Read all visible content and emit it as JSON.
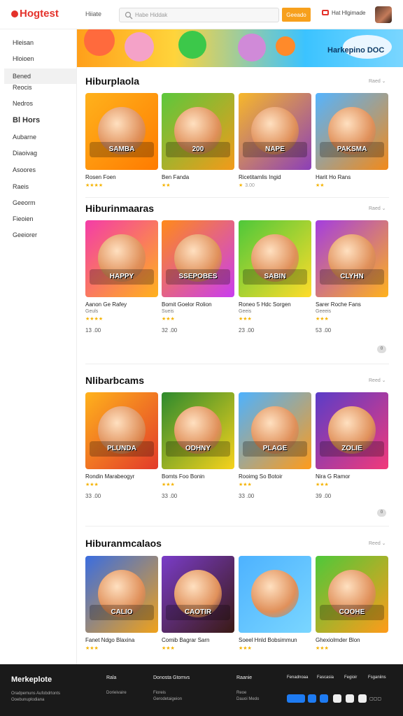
{
  "header": {
    "logo": "Hogtest",
    "nav_link": "Hiiate",
    "search_placeholder": "Habe Hiddak",
    "search_button": "Geeado",
    "signin": "Hat Hlgimade"
  },
  "sidebar": {
    "items": [
      "Hleisan",
      "Hloioen",
      "Bened",
      "Reocis",
      "Nedros",
      "Bl Hors",
      "Aubarne",
      "Diaoivag",
      "Asoores",
      "Raeis",
      "Geeorm",
      "Fieoien",
      "Geeiorer"
    ]
  },
  "banner": {
    "text": "Harkepino DOC"
  },
  "sections": [
    {
      "title": "Hiburplaola",
      "see_all": "Raed",
      "cards": [
        {
          "title": "Rosen Foen",
          "stars": "★★★★",
          "count": "",
          "thumb": "SAMBA",
          "colors": [
            "#ffb21c",
            "#ff7b00"
          ]
        },
        {
          "title": "Ben Fanda",
          "stars": "★★",
          "count": "",
          "thumb": "200",
          "colors": [
            "#5bc83c",
            "#f39a1a"
          ]
        },
        {
          "title": "Ricetitamlis Ingid",
          "stars": "★",
          "count": "3.00",
          "thumb": "NAPE",
          "colors": [
            "#f7b82a",
            "#8c3fb8"
          ]
        },
        {
          "title": "Harit Ho Rans",
          "stars": "★★",
          "count": "",
          "thumb": "PAKSMA",
          "colors": [
            "#54b4ff",
            "#f28a1a"
          ]
        }
      ]
    },
    {
      "title": "Hiburinmaaras",
      "see_all": "Raed",
      "cards": [
        {
          "title": "Aanon Ge Rafey",
          "sub": "Geuls",
          "stars": "★★★★",
          "price": "13 .00",
          "thumb": "HAPPY",
          "colors": [
            "#f43ca8",
            "#ffb21c"
          ]
        },
        {
          "title": "Bomit Goelor Rolion",
          "sub": "Sueis",
          "stars": "★★★",
          "price": "32 .00",
          "thumb": "SSEPOBES",
          "colors": [
            "#ff8a1a",
            "#c93df0"
          ]
        },
        {
          "title": "Roneo 5 Hdc Sorgen",
          "sub": "Geeis",
          "stars": "★★★",
          "price": "23 .00",
          "thumb": "SABIN",
          "colors": [
            "#4ec83a",
            "#ffdc2a"
          ]
        },
        {
          "title": "Sarer Roche Fans",
          "sub": "Geeeis",
          "stars": "★★★",
          "price": "53 .00",
          "thumb": "CLYHN",
          "colors": [
            "#a43de0",
            "#ffb21c"
          ]
        }
      ],
      "badge": "0"
    },
    {
      "title": "Nlibarbcams",
      "see_all": "Reed",
      "cards": [
        {
          "title": "Rondin Marabeogyr",
          "sub": "",
          "stars": "★★★",
          "price": "33 .00",
          "thumb": "PLUNDA",
          "colors": [
            "#ffb21c",
            "#e23a2a"
          ]
        },
        {
          "title": "Bomts Foo Bonin",
          "sub": "",
          "stars": "★★★",
          "price": "33 .00",
          "thumb": "ODHNY",
          "colors": [
            "#2d8a2d",
            "#f7d21c"
          ]
        },
        {
          "title": "Rooimg So Botoir",
          "sub": "",
          "stars": "★★★",
          "price": "33 .00",
          "thumb": "PLAGE",
          "colors": [
            "#4db2ff",
            "#ff9b1a"
          ]
        },
        {
          "title": "Nira G Ramor",
          "sub": "",
          "stars": "★★★",
          "price": "39 .00",
          "thumb": "ZOLIE",
          "colors": [
            "#5a3cc8",
            "#f23a7a"
          ]
        }
      ],
      "badge": "0"
    },
    {
      "title": "Hiburanmcalaos",
      "see_all": "Reed",
      "cards": [
        {
          "title": "Fanet Ndgo Blaxina",
          "stars": "★★★",
          "thumb": "CALIO",
          "colors": [
            "#3a6de0",
            "#f0a21a"
          ]
        },
        {
          "title": "Comib Bagrar Sarn",
          "stars": "★★★",
          "thumb": "CAOTIR",
          "colors": [
            "#7a3cc8",
            "#3a1a14"
          ]
        },
        {
          "title": "Soeel Hnld Bobsimmun",
          "stars": "★★★",
          "thumb": "",
          "colors": [
            "#4db2ff",
            "#7ad6ff"
          ]
        },
        {
          "title": "Ghexiolmder Blon",
          "stars": "★★★",
          "thumb": "COOHE",
          "colors": [
            "#4ec83a",
            "#ff9b1a"
          ]
        }
      ]
    }
  ],
  "footer": {
    "brand": "Merkeplote",
    "brand_text": "Oradpemuns Aufobdrtonts Ooebunuplodiana",
    "cols": [
      {
        "head": "Rala",
        "lines": [
          "Dorieivaire"
        ]
      },
      {
        "head": "Donosta Gtomvs",
        "lines": [
          "Fioreis",
          "Gerodetaigeion"
        ]
      },
      {
        "head": "Raanie",
        "lines": [
          "Reoe",
          "Dauoi Medo"
        ]
      },
      {
        "head": "Fenadnoaa",
        "lines": []
      },
      {
        "head": "Fascasia",
        "lines": []
      },
      {
        "head": "Fegioir",
        "lines": []
      },
      {
        "head": "Fsganiins",
        "lines": []
      }
    ]
  }
}
